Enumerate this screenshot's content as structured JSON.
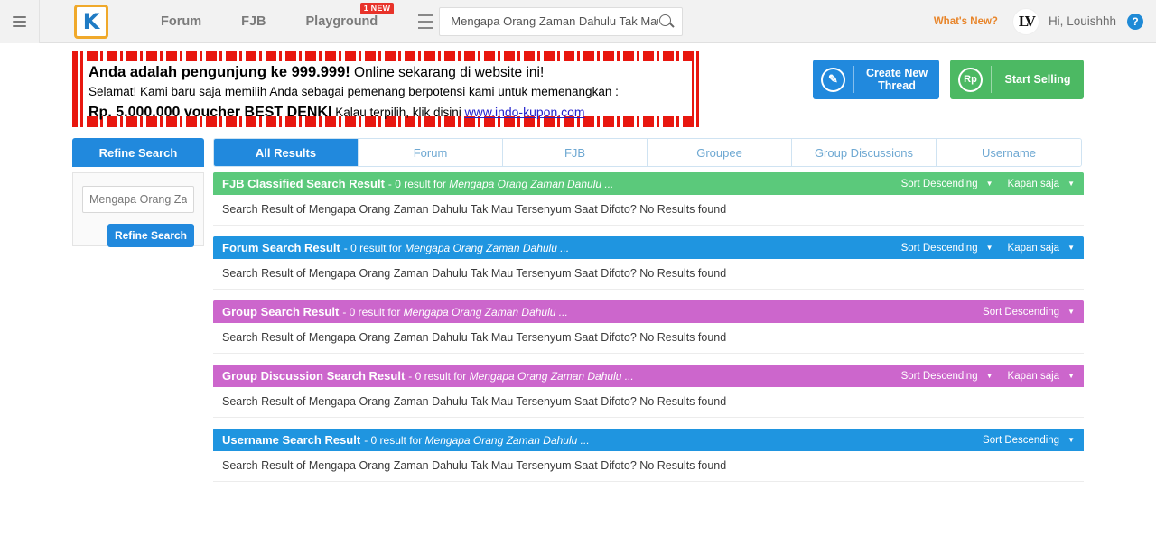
{
  "topbar": {
    "menu_icon": "hamburger-icon",
    "logo_text": "K",
    "nav": [
      {
        "label": "Forum",
        "badge": ""
      },
      {
        "label": "FJB",
        "badge": ""
      },
      {
        "label": "Playground",
        "badge": "1 NEW"
      }
    ],
    "search": {
      "value": "Mengapa Orang Zaman Dahulu Tak Mau Ters",
      "placeholder": "Search...",
      "icon": "search-icon"
    },
    "whats_new": "What's New?",
    "avatar_text": "LV",
    "greeting": "Hi, Louishhh",
    "help_label": "?"
  },
  "ad": {
    "line1_bold": "Anda adalah pengunjung ke 999.999!",
    "line1_rest": " Online sekarang di website ini!",
    "line2": "Selamat! Kami baru saja memilih Anda sebagai pemenang berpotensi kami untuk memenangkan :",
    "line3_bold": "Rp. 5.000.000 voucher BEST DENKI",
    "line3_rest": " Kalau terpilih, klik disini ",
    "link": "www.indo-kupon.com"
  },
  "actions": {
    "create_thread": "Create New Thread",
    "create_thread_icon": "pencil-icon",
    "start_selling": "Start Selling",
    "start_selling_icon": "rupiah-icon",
    "rp_glyph": "Rp",
    "pencil_glyph": "✎"
  },
  "tabs": {
    "refine": "Refine Search",
    "items": [
      {
        "label": "All Results",
        "active": true
      },
      {
        "label": "Forum",
        "active": false
      },
      {
        "label": "FJB",
        "active": false
      },
      {
        "label": "Groupee",
        "active": false
      },
      {
        "label": "Group Discussions",
        "active": false
      },
      {
        "label": "Username",
        "active": false
      }
    ]
  },
  "sidebar": {
    "input_value": "Mengapa Orang Za",
    "input_placeholder": "Keyword",
    "button": "Refine Search"
  },
  "results": [
    {
      "title": "FJB Classified Search Result",
      "meta_prefix": " - 0 result for ",
      "query_short": "Mengapa Orang Zaman Dahulu ...",
      "color": "green",
      "sort": "Sort Descending",
      "time": "Kapan saja",
      "body": "Search Result of Mengapa Orang Zaman Dahulu Tak Mau Tersenyum Saat Difoto? No Results found"
    },
    {
      "title": "Forum Search Result",
      "meta_prefix": " - 0 result for ",
      "query_short": "Mengapa Orang Zaman Dahulu ...",
      "color": "blue",
      "sort": "Sort Descending",
      "time": "Kapan saja",
      "body": "Search Result of Mengapa Orang Zaman Dahulu Tak Mau Tersenyum Saat Difoto? No Results found"
    },
    {
      "title": "Group Search Result",
      "meta_prefix": " - 0 result for ",
      "query_short": "Mengapa Orang Zaman Dahulu ...",
      "color": "purple",
      "sort": "Sort Descending",
      "time": "",
      "body": "Search Result of Mengapa Orang Zaman Dahulu Tak Mau Tersenyum Saat Difoto? No Results found"
    },
    {
      "title": "Group Discussion Search Result",
      "meta_prefix": " - 0 result for ",
      "query_short": "Mengapa Orang Zaman Dahulu ...",
      "color": "purple",
      "sort": "Sort Descending",
      "time": "Kapan saja",
      "body": "Search Result of Mengapa Orang Zaman Dahulu Tak Mau Tersenyum Saat Difoto? No Results found"
    },
    {
      "title": "Username Search Result",
      "meta_prefix": " - 0 result for ",
      "query_short": "Mengapa Orang Zaman Dahulu ...",
      "color": "blue",
      "sort": "Sort Descending",
      "time": "",
      "body": "Search Result of Mengapa Orang Zaman Dahulu Tak Mau Tersenyum Saat Difoto? No Results found"
    }
  ],
  "colors": {
    "accent_blue": "#2189dd",
    "green": "#5bc97b",
    "blue": "#1f95e0",
    "purple": "#cc66cc",
    "orange": "#e8852a",
    "ad_red": "#e8170f"
  }
}
